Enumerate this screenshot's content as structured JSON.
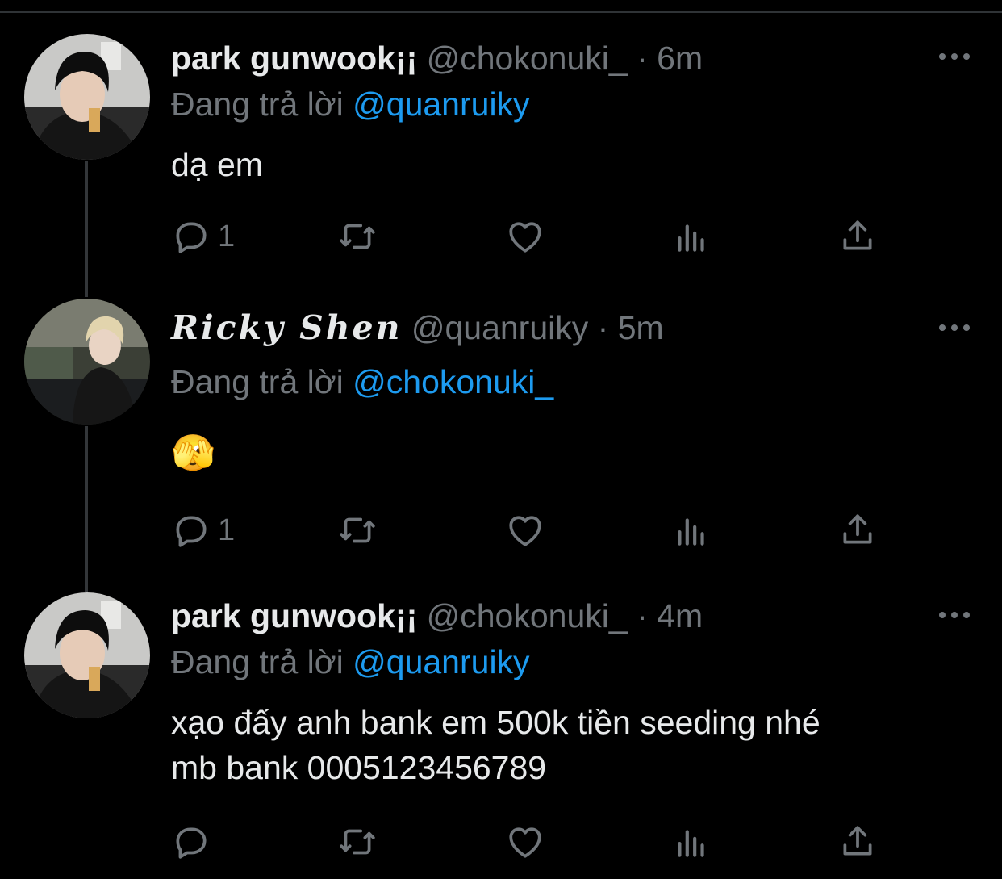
{
  "colors": {
    "background": "#000000",
    "text": "#e7e9ea",
    "muted": "#71767b",
    "link": "#1d9bf0",
    "thread_line": "#333639"
  },
  "tweets": [
    {
      "name": "park gunwook¡¡",
      "handle": "@chokonuki_",
      "sep": "·",
      "time": "6m",
      "reply_prefix": "Đang trả lời",
      "reply_to": "@quanruiky",
      "text_lines": [
        "dạ em"
      ],
      "reply_count": "1",
      "avatar": "avatar-dark-hair"
    },
    {
      "name": "𝑹𝒊𝒄𝒌𝒚 𝑺𝒉𝒆𝒏",
      "handle": "@quanruiky",
      "sep": "·",
      "time": "5m",
      "reply_prefix": "Đang trả lời",
      "reply_to": "@chokonuki_",
      "text_lines": [
        "🫣"
      ],
      "reply_count": "1",
      "avatar": "avatar-blonde-hair"
    },
    {
      "name": "park gunwook¡¡",
      "handle": "@chokonuki_",
      "sep": "·",
      "time": "4m",
      "reply_prefix": "Đang trả lời",
      "reply_to": "@quanruiky",
      "text_lines": [
        "xạo đấy anh bank em 500k tiền seeding nhé",
        "mb bank 0005123456789"
      ],
      "reply_count": "",
      "avatar": "avatar-dark-hair"
    }
  ],
  "icons": [
    "reply-icon",
    "retweet-icon",
    "like-icon",
    "views-icon",
    "share-icon",
    "more-icon"
  ]
}
